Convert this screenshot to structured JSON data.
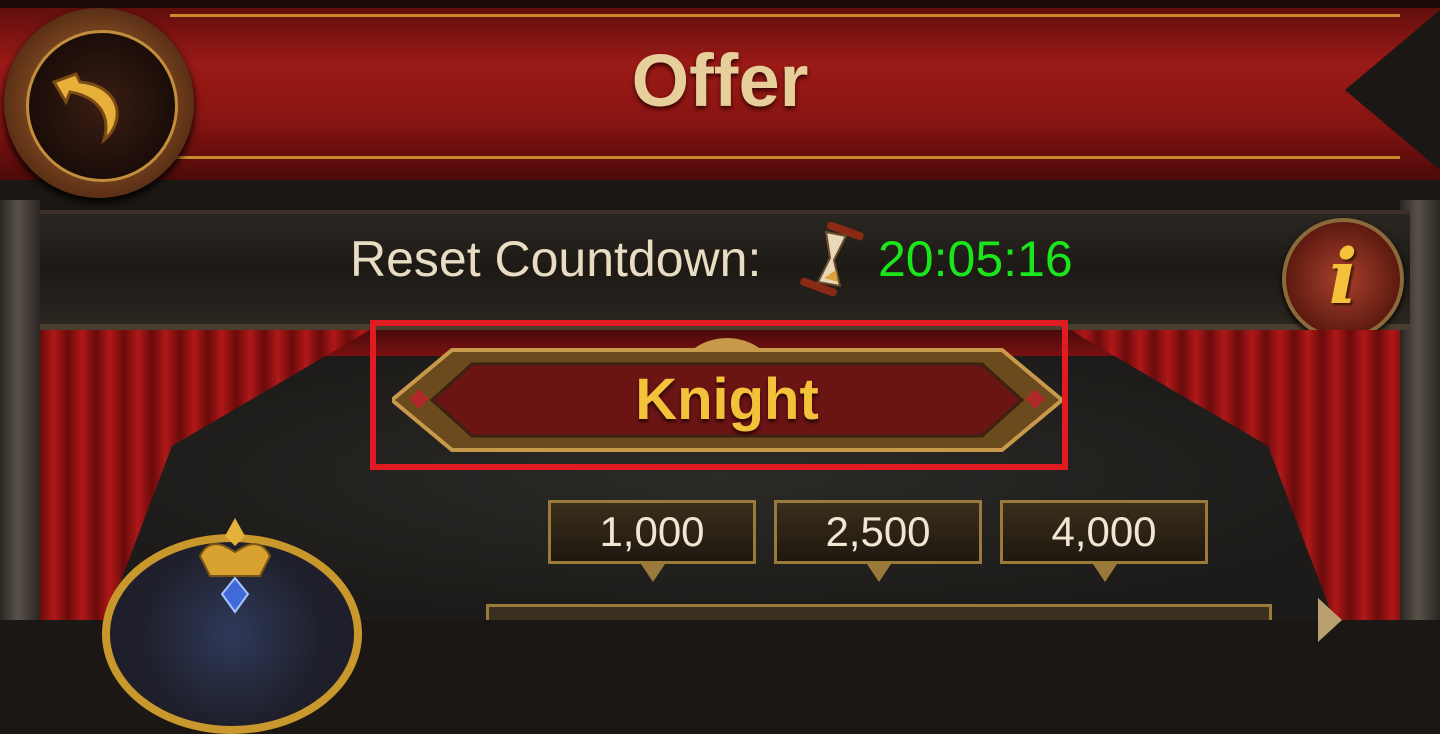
{
  "header": {
    "title": "Offer",
    "back_icon": "back-arrow-icon"
  },
  "countdown": {
    "label": "Reset Countdown:",
    "icon": "hourglass-icon",
    "value": "20:05:16",
    "value_color": "#1be51b"
  },
  "info": {
    "icon": "info-icon",
    "glyph": "i"
  },
  "tier": {
    "label": "Knight",
    "label_color": "#f4c23a",
    "highlight_color": "#e01b22"
  },
  "amount_tabs": [
    {
      "label": "1,000"
    },
    {
      "label": "2,500"
    },
    {
      "label": "4,000"
    }
  ]
}
